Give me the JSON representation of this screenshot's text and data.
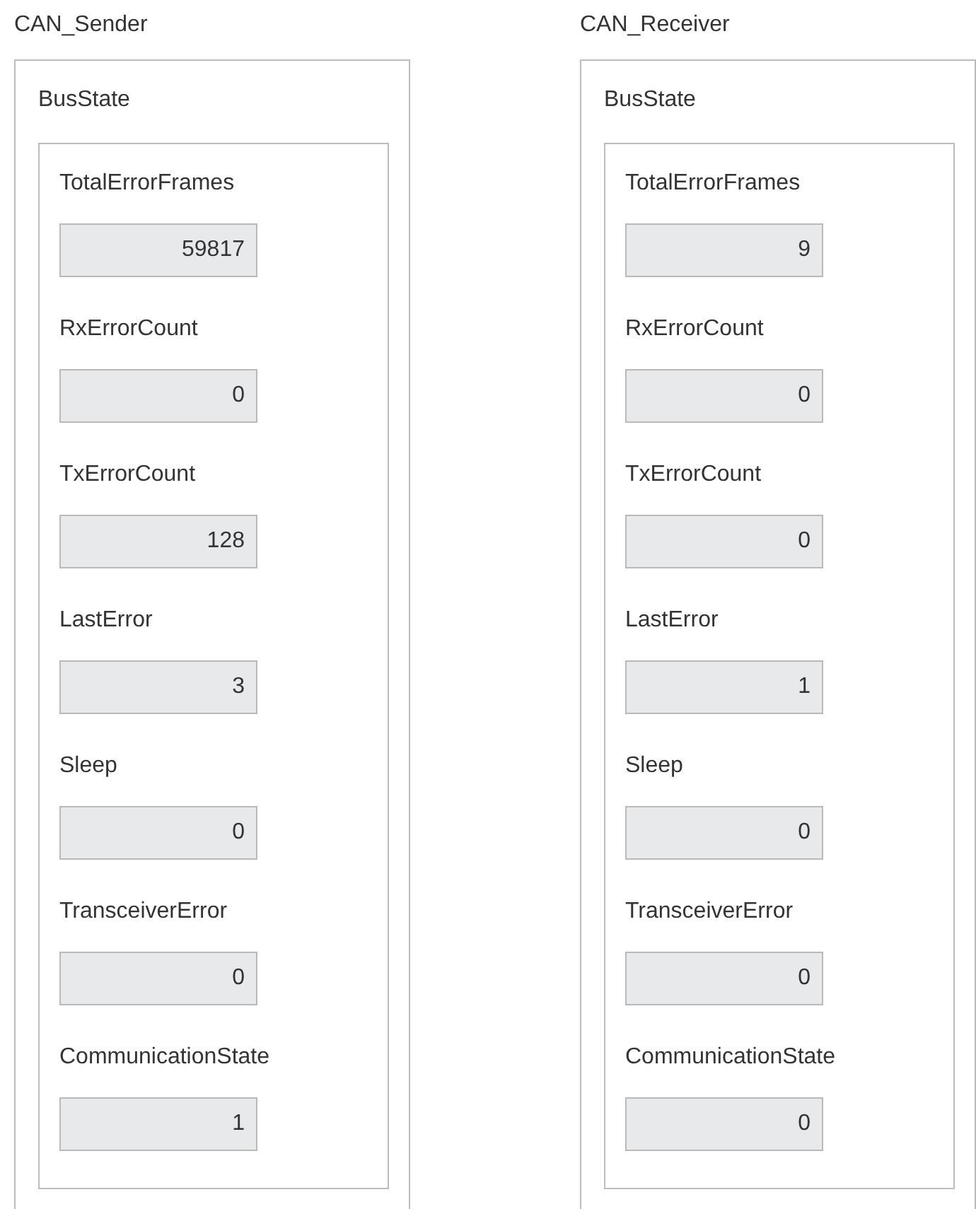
{
  "panels": [
    {
      "title": "CAN_Sender",
      "group": {
        "title": "BusState",
        "fields": [
          {
            "label": "TotalErrorFrames",
            "value": "59817"
          },
          {
            "label": "RxErrorCount",
            "value": "0"
          },
          {
            "label": "TxErrorCount",
            "value": "128"
          },
          {
            "label": "LastError",
            "value": "3"
          },
          {
            "label": "Sleep",
            "value": "0"
          },
          {
            "label": "TransceiverError",
            "value": "0"
          },
          {
            "label": "CommunicationState",
            "value": "1"
          }
        ]
      }
    },
    {
      "title": "CAN_Receiver",
      "group": {
        "title": "BusState",
        "fields": [
          {
            "label": "TotalErrorFrames",
            "value": "9"
          },
          {
            "label": "RxErrorCount",
            "value": "0"
          },
          {
            "label": "TxErrorCount",
            "value": "0"
          },
          {
            "label": "LastError",
            "value": "1"
          },
          {
            "label": "Sleep",
            "value": "0"
          },
          {
            "label": "TransceiverError",
            "value": "0"
          },
          {
            "label": "CommunicationState",
            "value": "0"
          }
        ]
      }
    }
  ]
}
